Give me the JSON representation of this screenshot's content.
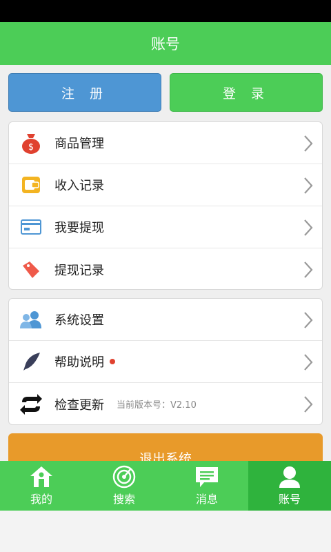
{
  "header": {
    "title": "账号"
  },
  "auth": {
    "register_label": "注 册",
    "login_label": "登 录"
  },
  "menu_group_1": [
    {
      "label": "商品管理",
      "icon": "money-bag-icon"
    },
    {
      "label": "收入记录",
      "icon": "wallet-icon"
    },
    {
      "label": "我要提现",
      "icon": "card-icon"
    },
    {
      "label": "提现记录",
      "icon": "tag-icon"
    }
  ],
  "menu_group_2": [
    {
      "label": "系统设置",
      "icon": "users-icon"
    },
    {
      "label": "帮助说明",
      "icon": "feather-icon",
      "badge": true
    },
    {
      "label": "检查更新",
      "icon": "refresh-icon",
      "version": "当前版本号：V2.10"
    }
  ],
  "logout_label": "退出系统",
  "tabs": [
    {
      "label": "我的",
      "icon": "home-icon",
      "active": false
    },
    {
      "label": "搜索",
      "icon": "radar-icon",
      "active": false
    },
    {
      "label": "消息",
      "icon": "message-icon",
      "active": false
    },
    {
      "label": "账号",
      "icon": "person-icon",
      "active": true
    }
  ],
  "colors": {
    "green": "#4ccd57",
    "blue": "#4e96d4",
    "orange": "#e89a2a",
    "badge": "#e0412f"
  }
}
